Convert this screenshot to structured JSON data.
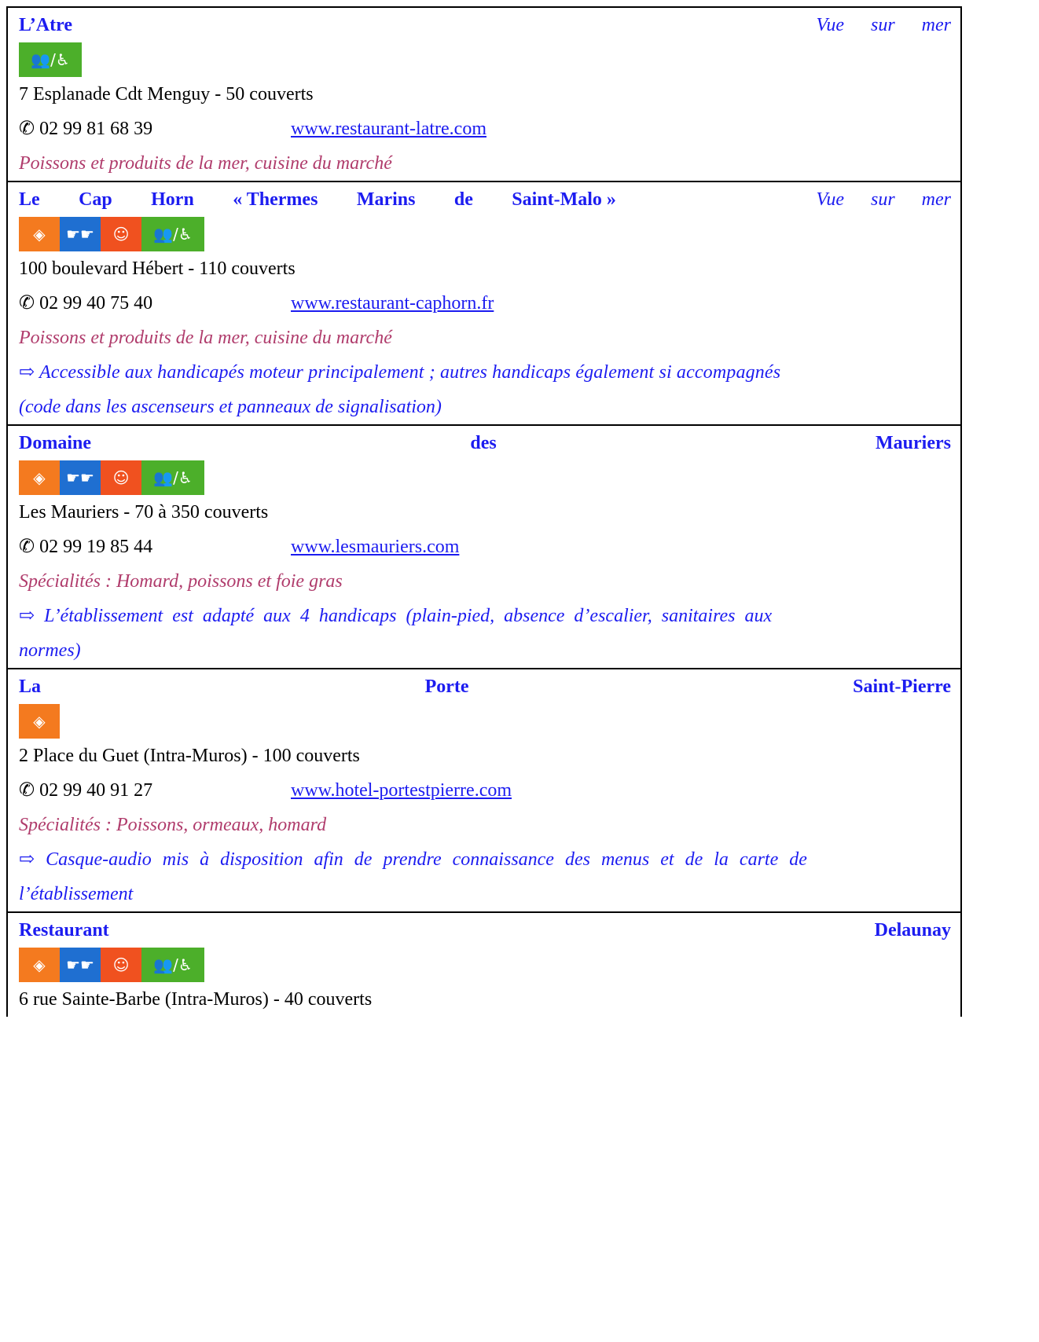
{
  "icon_legend": {
    "visual": "eye-icon",
    "auditory": "hands-sign-icon",
    "mental": "face-icon",
    "motor": "persons-wheelchair-icon"
  },
  "badge_glyphs": {
    "visual": "◈",
    "auditory": "☛☛",
    "mental": "☺",
    "motor": "👥/♿"
  },
  "phone_prefix": "✆",
  "note_arrow": "⇨",
  "entries": [
    {
      "name_words": [
        "L’Atre"
      ],
      "tag": "Vue sur mer",
      "address": "7 Esplanade Cdt Menguy - 50 couverts",
      "phone": "02 99 81 68 39",
      "website": "www.restaurant-latre.com",
      "specialty": "Poissons et produits de la mer, cuisine du marché"
    },
    {
      "name_words": [
        "Le",
        "Cap",
        "Horn",
        "« Thermes",
        "Marins",
        "de",
        "Saint-Malo »"
      ],
      "tag": "Vue sur mer",
      "address": "100 boulevard Hébert - 110 couverts",
      "phone": "02 99 40 75 40",
      "website": "www.restaurant-caphorn.fr",
      "specialty": "Poissons et produits de la mer, cuisine du marché",
      "note_lines": [
        "⇨ Accessible aux handicapés moteur principalement ; autres handicaps également si accompagnés",
        "(code dans les ascenseurs et panneaux de signalisation)"
      ]
    },
    {
      "name_words": [
        "Domaine",
        "des",
        "Mauriers"
      ],
      "address": "Les Mauriers - 70 à 350 couverts",
      "phone": "02 99 19 85 44",
      "website": "www.lesmauriers.com",
      "specialty": "Spécialités : Homard, poissons et foie gras",
      "note_lines": [
        "⇨ L’établissement est adapté aux 4 handicaps (plain-pied, absence d’escalier, sanitaires aux",
        "normes)"
      ]
    },
    {
      "name_words": [
        "La",
        "Porte",
        "Saint-Pierre"
      ],
      "address": "2 Place du Guet (Intra-Muros) - 100 couverts",
      "phone": "02 99 40 91 27",
      "website": "www.hotel-portestpierre.com",
      "specialty": "Spécialités : Poissons, ormeaux, homard",
      "note_lines": [
        "⇨ Casque-audio mis à disposition afin de prendre connaissance des menus et de la carte de",
        "l’établissement"
      ]
    },
    {
      "name_words": [
        "Restaurant",
        "Delaunay"
      ],
      "address": "6 rue Sainte-Barbe (Intra-Muros) - 40 couverts"
    }
  ]
}
